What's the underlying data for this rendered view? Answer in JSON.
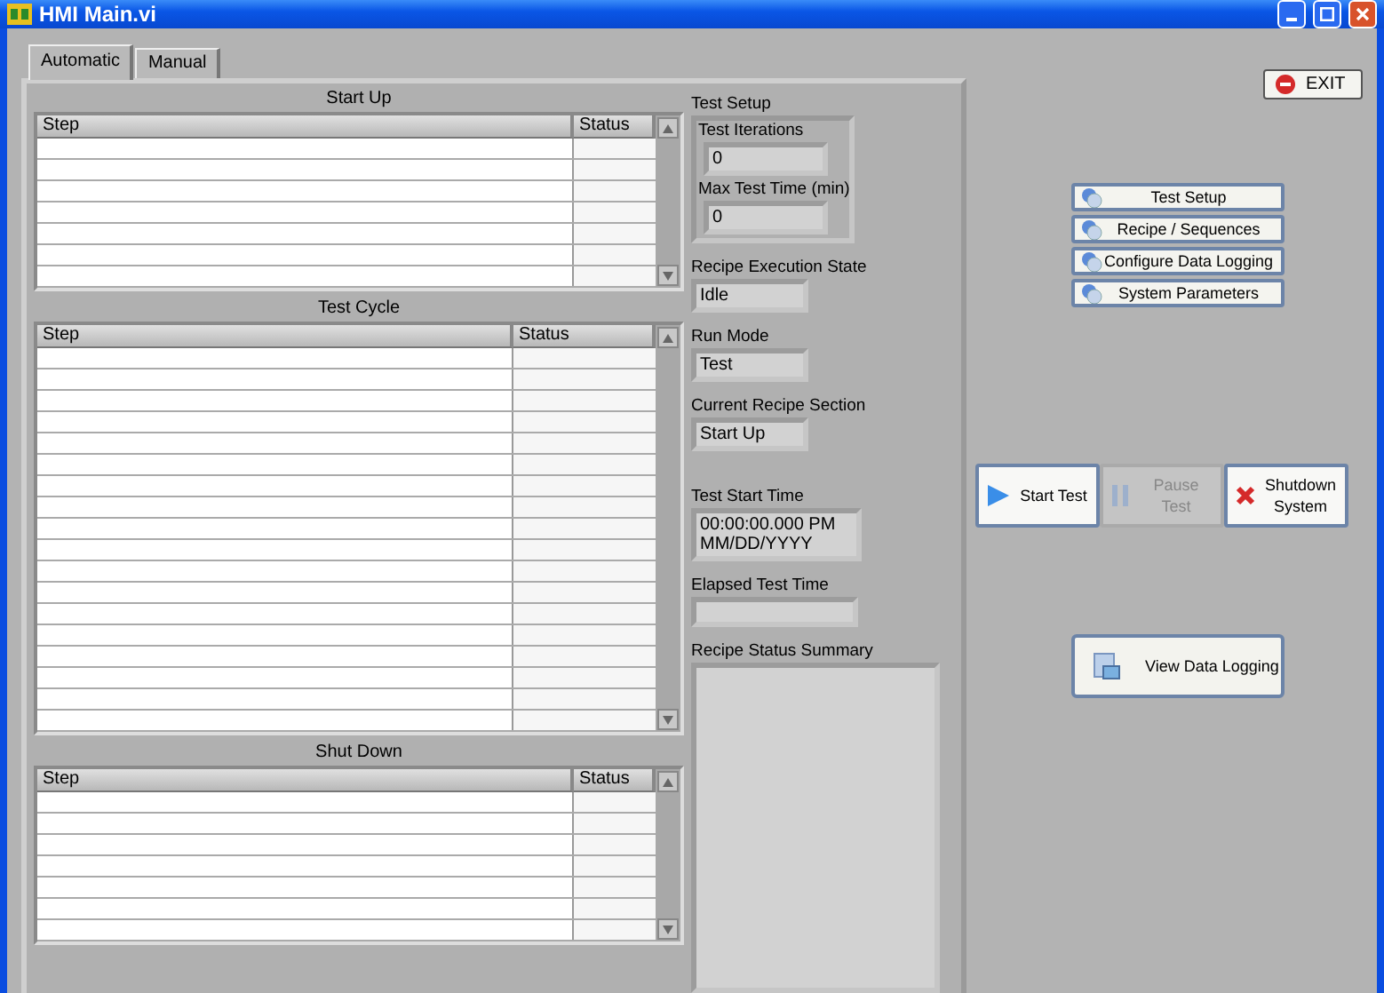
{
  "window": {
    "title": "HMI Main.vi"
  },
  "tabs": [
    {
      "label": "Automatic",
      "selected": true
    },
    {
      "label": "Manual",
      "selected": false
    }
  ],
  "tables": [
    {
      "title": "Start Up",
      "columns": [
        "Step",
        "Status"
      ]
    },
    {
      "title": "Test Cycle",
      "columns": [
        "Step",
        "Status"
      ]
    },
    {
      "title": "Shut Down",
      "columns": [
        "Step",
        "Status"
      ]
    }
  ],
  "test_setup": {
    "title": "Test Setup",
    "fields": [
      {
        "label": "Test Iterations",
        "value": "0"
      },
      {
        "label": "Max Test Time (min)",
        "value": "0"
      }
    ]
  },
  "indicators": [
    {
      "label": "Recipe Execution State",
      "value": [
        "Idle"
      ],
      "kind": "short"
    },
    {
      "label": "Run Mode",
      "value": [
        "Test"
      ],
      "kind": "short"
    },
    {
      "label": "Current Recipe Section",
      "value": [
        "Start Up"
      ],
      "kind": "short"
    },
    {
      "label": "Test Start Time",
      "value": [
        "00:00:00.000 PM",
        "MM/DD/YYYY"
      ],
      "kind": "short"
    },
    {
      "label": "Elapsed Test Time",
      "kind": "wide"
    },
    {
      "label": "Recipe Status Summary",
      "kind": "area"
    }
  ],
  "exit_button": {
    "label": "EXIT"
  },
  "nav_buttons": [
    "Test Setup",
    "Recipe / Sequences",
    "Configure Data Logging",
    "System Parameters"
  ],
  "action_buttons": [
    {
      "label": "Start Test",
      "kind": "start",
      "disabled": false
    },
    {
      "label": "Pause Test",
      "kind": "pause",
      "disabled": true
    },
    {
      "label": "Shutdown System",
      "kind": "shutdown",
      "disabled": false
    }
  ],
  "log_button": {
    "label": "View Data Logging"
  }
}
